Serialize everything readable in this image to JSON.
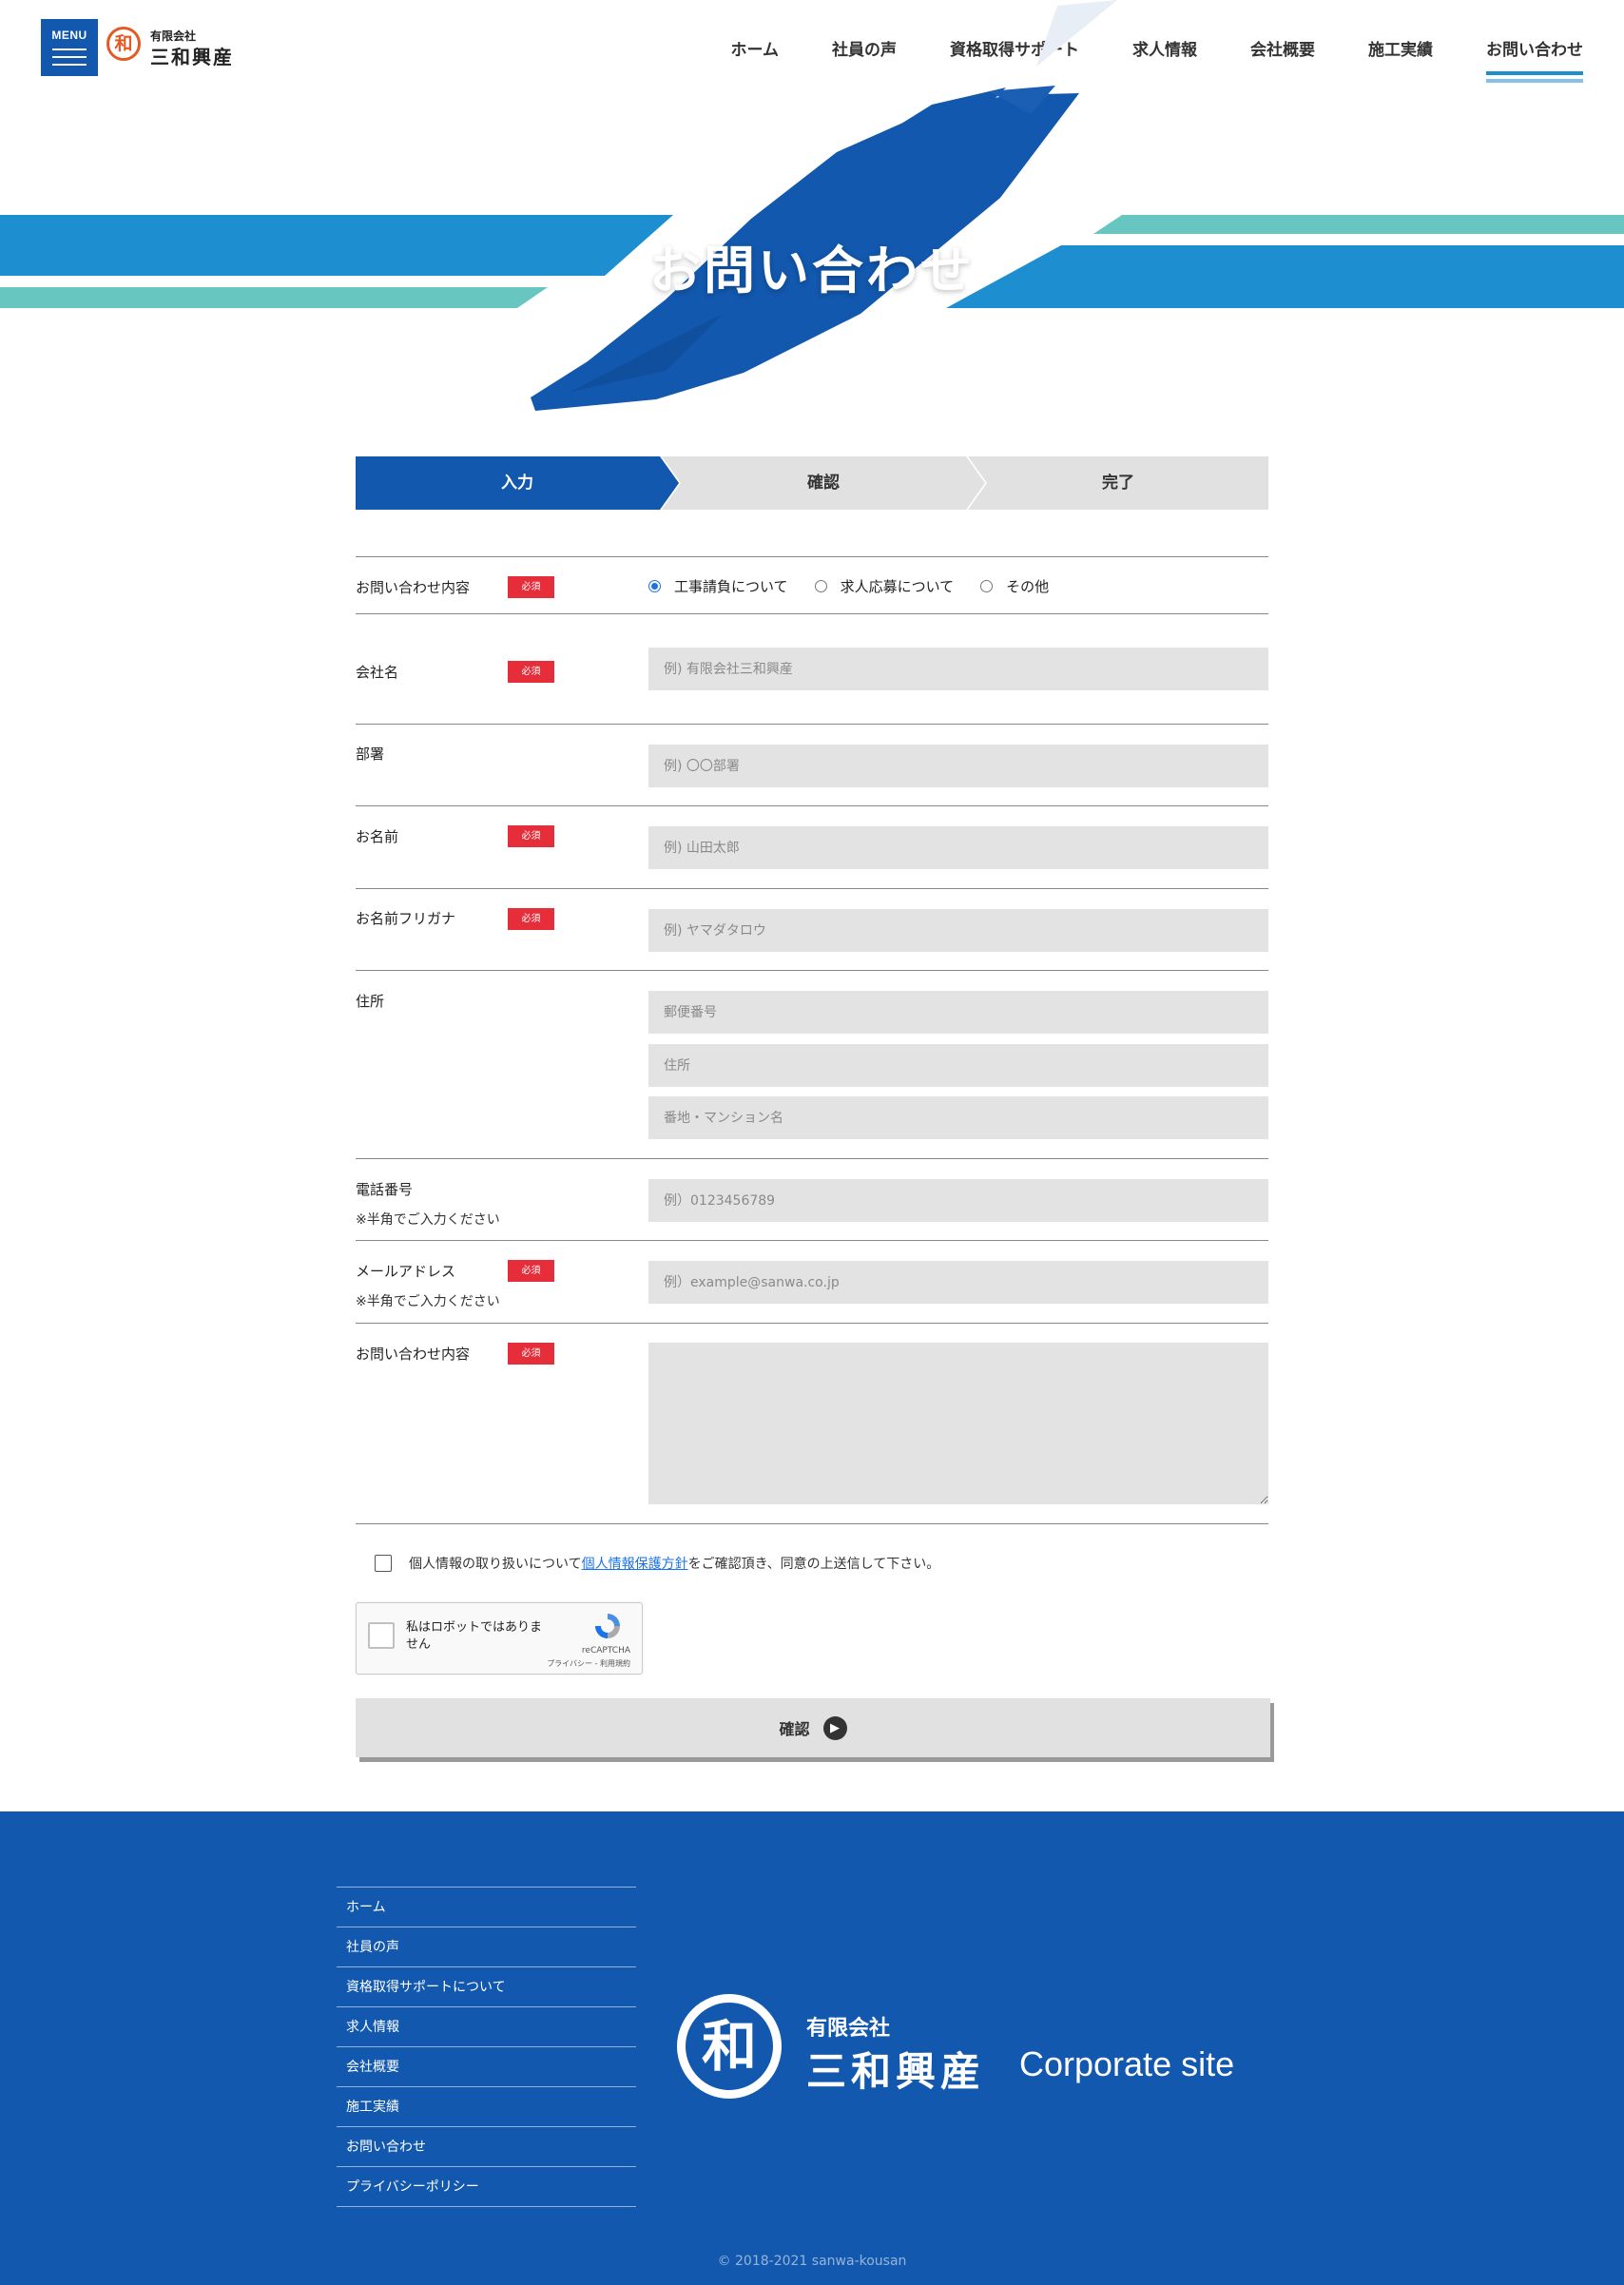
{
  "header": {
    "menu_label": "MENU",
    "logo_mark": "和",
    "logo_sub": "有限会社",
    "logo_main": "三和興産",
    "nav": [
      "ホーム",
      "社員の声",
      "資格取得サポート",
      "求人情報",
      "会社概要",
      "施工実績",
      "お問い合わせ"
    ],
    "active_nav": "お問い合わせ"
  },
  "hero": {
    "title": "お問い合わせ"
  },
  "colors": {
    "brand_blue": "#1258ae",
    "stripe_blue": "#1d8fd1",
    "stripe_teal": "#67c7c0",
    "required_red": "#e62e3a",
    "field_gray": "#e3e3e3"
  },
  "steps": [
    "入力",
    "確認",
    "完了"
  ],
  "current_step": "入力",
  "form": {
    "required_badge": "必須",
    "inquiry_type": {
      "label": "お問い合わせ内容",
      "options": [
        "工事請負について",
        "求人応募について",
        "その他"
      ],
      "selected": "工事請負について"
    },
    "company": {
      "label": "会社名",
      "placeholder": "例) 有限会社三和興産"
    },
    "department": {
      "label": "部署",
      "placeholder": "例) 〇〇部署"
    },
    "name": {
      "label": "お名前",
      "placeholder": "例) 山田太郎"
    },
    "kana": {
      "label": "お名前フリガナ",
      "placeholder": "例) ヤマダタロウ"
    },
    "address": {
      "label": "住所",
      "postal_placeholder": "郵便番号",
      "address_placeholder": "住所",
      "building_placeholder": "番地・マンション名"
    },
    "phone": {
      "label": "電話番号",
      "note": "※半角でご入力ください",
      "placeholder": "例）0123456789"
    },
    "email": {
      "label": "メールアドレス",
      "note": "※半角でご入力ください",
      "placeholder": "例）example@sanwa.co.jp"
    },
    "message": {
      "label": "お問い合わせ内容"
    },
    "consent": {
      "before": "個人情報の取り扱いについて ",
      "link": "個人情報保護方針",
      "after": "をご確認頂き、同意の上送信して下さい。"
    },
    "recaptcha": {
      "text": "私はロボットではありません",
      "brand": "reCAPTCHA",
      "links": "プライバシー - 利用規約"
    },
    "submit_label": "確認"
  },
  "footer": {
    "nav": [
      "ホーム",
      "社員の声",
      "資格取得サポートについて",
      "求人情報",
      "会社概要",
      "施工実績",
      "お問い合わせ",
      "プライバシーポリシー"
    ],
    "logo_mark": "和",
    "logo_sub": "有限会社",
    "logo_main": "三和興産",
    "corporate": "Corporate site",
    "copyright": "© 2018-2021 sanwa-kousan"
  }
}
